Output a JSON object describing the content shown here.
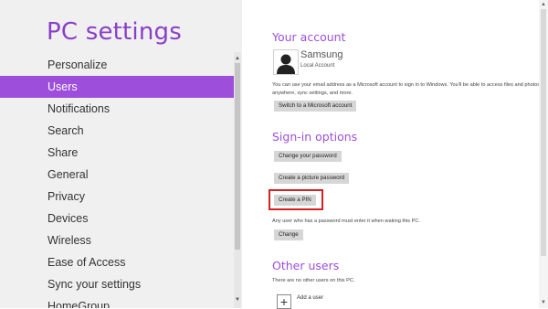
{
  "sidebar": {
    "title": "PC settings",
    "items": [
      {
        "label": "Personalize"
      },
      {
        "label": "Users"
      },
      {
        "label": "Notifications"
      },
      {
        "label": "Search"
      },
      {
        "label": "Share"
      },
      {
        "label": "General"
      },
      {
        "label": "Privacy"
      },
      {
        "label": "Devices"
      },
      {
        "label": "Wireless"
      },
      {
        "label": "Ease of Access"
      },
      {
        "label": "Sync your settings"
      },
      {
        "label": "HomeGroup"
      }
    ],
    "selected": "Users"
  },
  "account": {
    "heading": "Your account",
    "name": "Samsung",
    "type": "Local Account",
    "description": "You can use your email address as a Microsoft account to sign in to Windows. You'll be able to access files and photos anywhere, sync settings, and more.",
    "switch_button": "Switch to a Microsoft account"
  },
  "signin": {
    "heading": "Sign-in options",
    "change_password_button": "Change your password",
    "picture_password_button": "Create a picture password",
    "pin_button": "Create a PIN",
    "wake_text": "Any user who has a password must enter it when waking this PC.",
    "change_button": "Change"
  },
  "other_users": {
    "heading": "Other users",
    "empty_text": "There are no other users on this PC.",
    "add_user_label": "Add a user"
  },
  "colors": {
    "accent": "#9d4edb",
    "title": "#8a3fc8",
    "focus_outline": "#d52020",
    "sidebar_bg": "#f0f0f0"
  }
}
